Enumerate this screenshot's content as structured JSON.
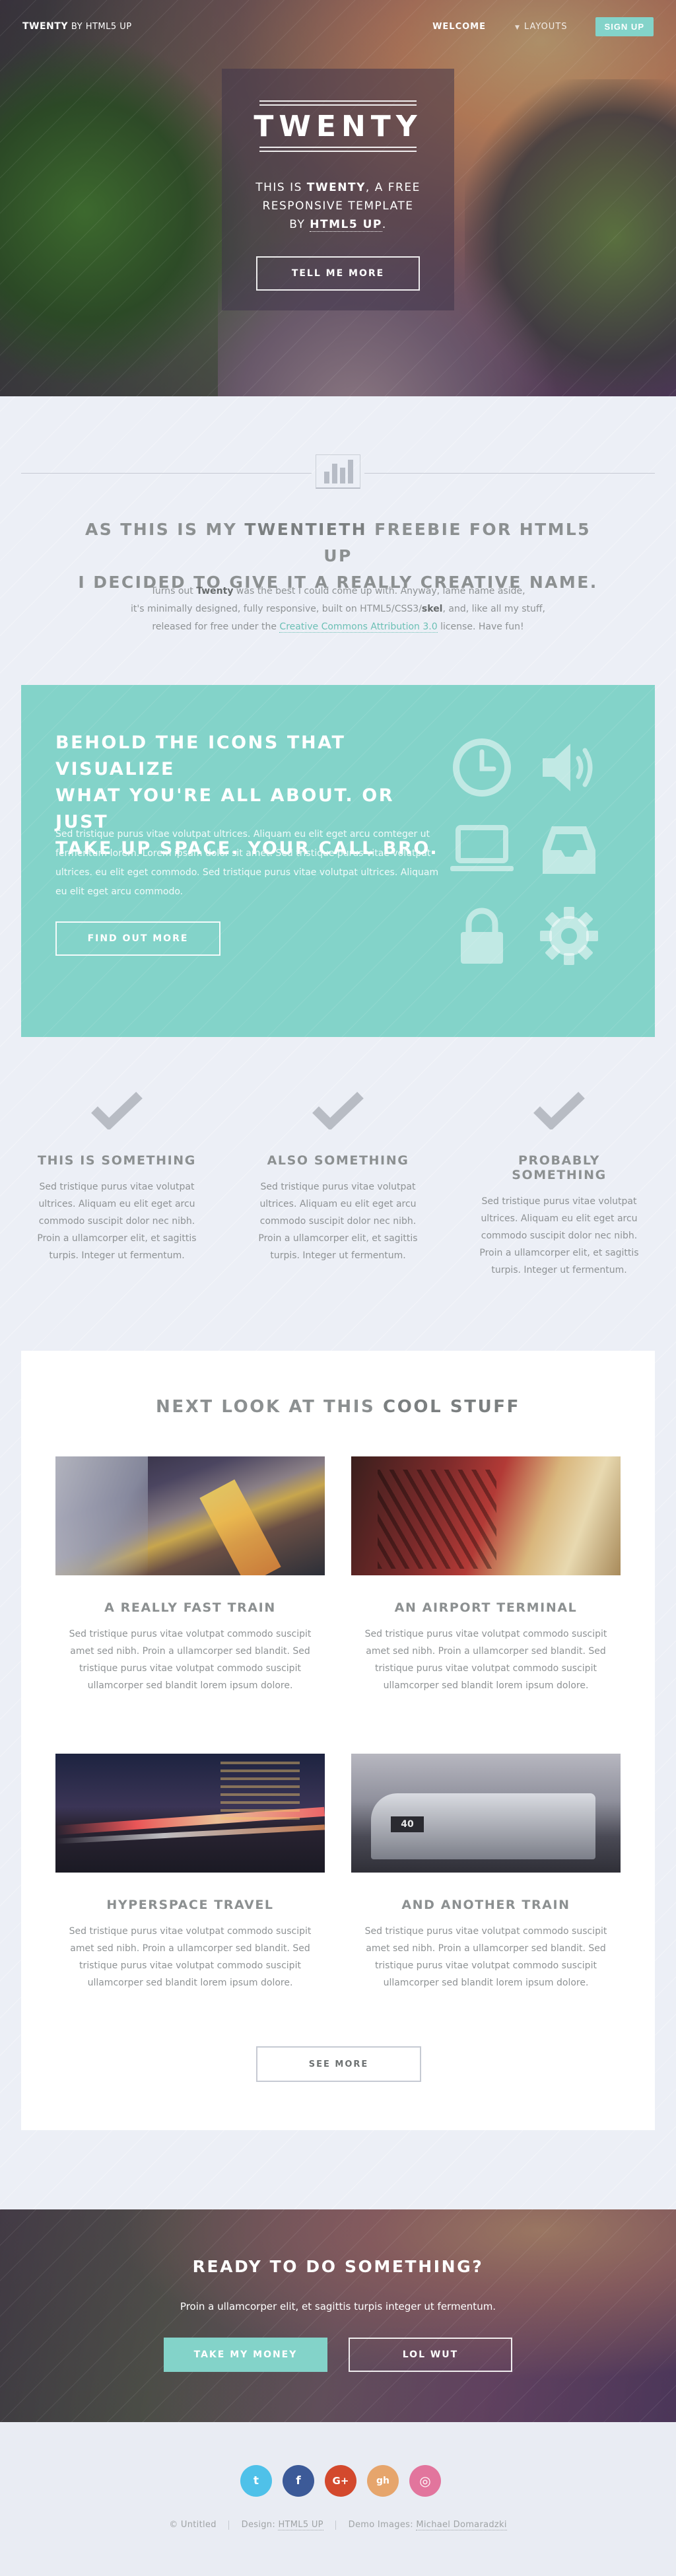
{
  "header": {
    "logo_bold": "TWENTY",
    "logo_rest": "BY HTML5 UP",
    "nav": {
      "welcome": "WELCOME",
      "layouts": "LAYOUTS",
      "signup": "SIGN UP"
    }
  },
  "hero": {
    "title": "TWENTY",
    "sub_line1_pre": "THIS IS ",
    "sub_line1_bold": "TWENTY",
    "sub_line1_post": ", A FREE",
    "sub_line2": "RESPONSIVE TEMPLATE",
    "sub_line3_pre": "BY ",
    "sub_line3_link": "HTML5 UP",
    "sub_line3_post": ".",
    "button": "TELL ME MORE"
  },
  "intro": {
    "title_pre": "AS THIS IS MY ",
    "title_bold": "TWENTIETH",
    "title_post": " FREEBIE FOR HTML5 UP",
    "title_line2": "I DECIDED TO GIVE IT A REALLY CREATIVE NAME.",
    "text_1": "Turns out ",
    "text_bold1": "Twenty",
    "text_2": " was the best I could come up with. Anyway, lame name aside,",
    "text_3": "it's minimally designed, fully responsive, built on HTML5/CSS3/",
    "text_bold2": "skel",
    "text_4": ", and, like all my stuff,",
    "text_5": "released for free under the ",
    "text_link": "Creative Commons Attribution 3.0",
    "text_6": " license. Have fun!"
  },
  "icons_box": {
    "title_1": "BEHOLD THE ",
    "title_bold": "ICONS",
    "title_2": " THAT VISUALIZE",
    "title_line2": "WHAT YOU'RE ALL ABOUT. OR JUST",
    "title_line3": "TAKE UP SPACE. YOUR CALL BRO.",
    "text": "Sed tristique purus vitae volutpat ultrices. Aliquam eu elit eget arcu comteger ut fermentum lorem. Lorem ipsum dolor sit amet. Sed tristique purus vitae volutpat ultrices. eu elit eget commodo. Sed tristique purus vitae volutpat ultrices. Aliquam eu elit eget arcu commodo.",
    "button": "FIND OUT MORE",
    "icons": [
      "clock-icon",
      "volume-icon",
      "laptop-icon",
      "inbox-icon",
      "lock-icon",
      "gear-icon"
    ]
  },
  "features": [
    {
      "title": "THIS IS SOMETHING",
      "text": "Sed tristique purus vitae volutpat ultrices. Aliquam eu elit eget arcu commodo suscipit dolor nec nibh. Proin a ullamcorper elit, et sagittis turpis. Integer ut fermentum."
    },
    {
      "title": "ALSO SOMETHING",
      "text": "Sed tristique purus vitae volutpat ultrices. Aliquam eu elit eget arcu commodo suscipit dolor nec nibh. Proin a ullamcorper elit, et sagittis turpis. Integer ut fermentum."
    },
    {
      "title": "PROBABLY SOMETHING",
      "text": "Sed tristique purus vitae volutpat ultrices. Aliquam eu elit eget arcu commodo suscipit dolor nec nibh. Proin a ullamcorper elit, et sagittis turpis. Integer ut fermentum."
    }
  ],
  "cool": {
    "title_pre": "NEXT LOOK AT THIS ",
    "title_bold": "COOL STUFF",
    "cards": [
      {
        "title": "A REALLY FAST TRAIN",
        "text": "Sed tristique purus vitae volutpat commodo suscipit amet sed nibh. Proin a ullamcorper sed blandit. Sed tristique purus vitae volutpat commodo suscipit ullamcorper sed blandit lorem ipsum dolore."
      },
      {
        "title": "AN AIRPORT TERMINAL",
        "text": "Sed tristique purus vitae volutpat commodo suscipit amet sed nibh. Proin a ullamcorper sed blandit. Sed tristique purus vitae volutpat commodo suscipit ullamcorper sed blandit lorem ipsum dolore."
      },
      {
        "title": "HYPERSPACE TRAVEL",
        "text": "Sed tristique purus vitae volutpat commodo suscipit amet sed nibh. Proin a ullamcorper sed blandit. Sed tristique purus vitae volutpat commodo suscipit ullamcorper sed blandit lorem ipsum dolore."
      },
      {
        "title": "AND ANOTHER TRAIN",
        "text": "Sed tristique purus vitae volutpat commodo suscipit amet sed nibh. Proin a ullamcorper sed blandit. Sed tristique purus vitae volutpat commodo suscipit ullamcorper sed blandit lorem ipsum dolore."
      }
    ],
    "button": "SEE MORE"
  },
  "cta": {
    "title_pre": "READY TO DO ",
    "title_bold": "SOMETHING",
    "title_post": "?",
    "text": "Proin a ullamcorper elit, et sagittis turpis integer ut fermentum.",
    "button_primary": "TAKE MY MONEY",
    "button_secondary": "LOL WUT"
  },
  "footer": {
    "social": [
      {
        "name": "twitter-icon",
        "glyph": "t",
        "color": "#4fc1e9"
      },
      {
        "name": "facebook-icon",
        "glyph": "f",
        "color": "#3c5a98"
      },
      {
        "name": "google-plus-icon",
        "glyph": "G+",
        "color": "#d3492d"
      },
      {
        "name": "github-icon",
        "glyph": "gh",
        "color": "#e6a56c"
      },
      {
        "name": "dribbble-icon",
        "glyph": "◎",
        "color": "#e2759d"
      }
    ],
    "copyright": "© Untitled",
    "design_label": "Design: ",
    "design_link": "HTML5 UP",
    "images_label": "Demo Images: ",
    "images_link": "Michael Domaradzki"
  },
  "colors": {
    "accent": "#83d3c9",
    "text": "#7c8081",
    "background": "#eceff6"
  }
}
